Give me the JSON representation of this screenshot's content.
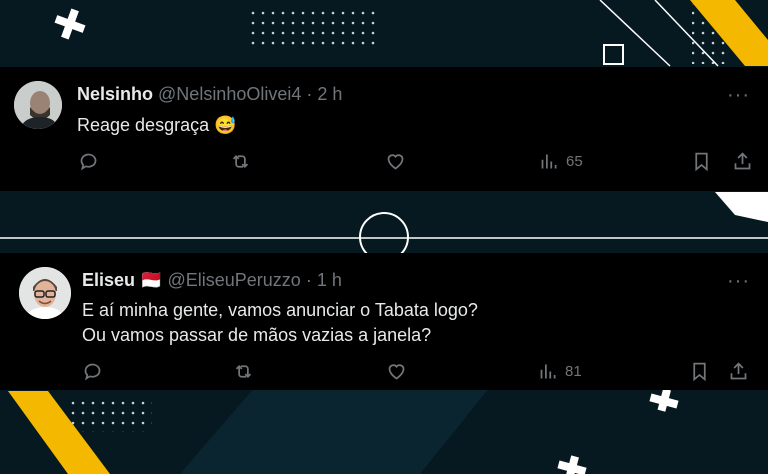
{
  "tweets": [
    {
      "name": "Nelsinho",
      "handle": "@NelsinhoOlivei4",
      "dot": "·",
      "time": "2 h",
      "text": "Reage desgraça",
      "emoji": "😅",
      "views": "65",
      "more": "···"
    },
    {
      "name": "Eliseu",
      "flag": "🇲🇨",
      "handle": "@EliseuPeruzzo",
      "dot": "·",
      "time": "1 h",
      "lines": [
        "E aí minha gente, vamos anunciar o Tabata logo?",
        "Ou vamos passar de mãos vazias a janela?"
      ],
      "views": "81",
      "more": "···"
    }
  ],
  "colors": {
    "background": "#061820",
    "accent": "#f5b800",
    "card": "#000000",
    "text": "#e7e9ea",
    "muted": "#71767b"
  },
  "icons": [
    "reply-icon",
    "retweet-icon",
    "like-icon",
    "views-icon",
    "bookmark-icon",
    "share-icon"
  ]
}
